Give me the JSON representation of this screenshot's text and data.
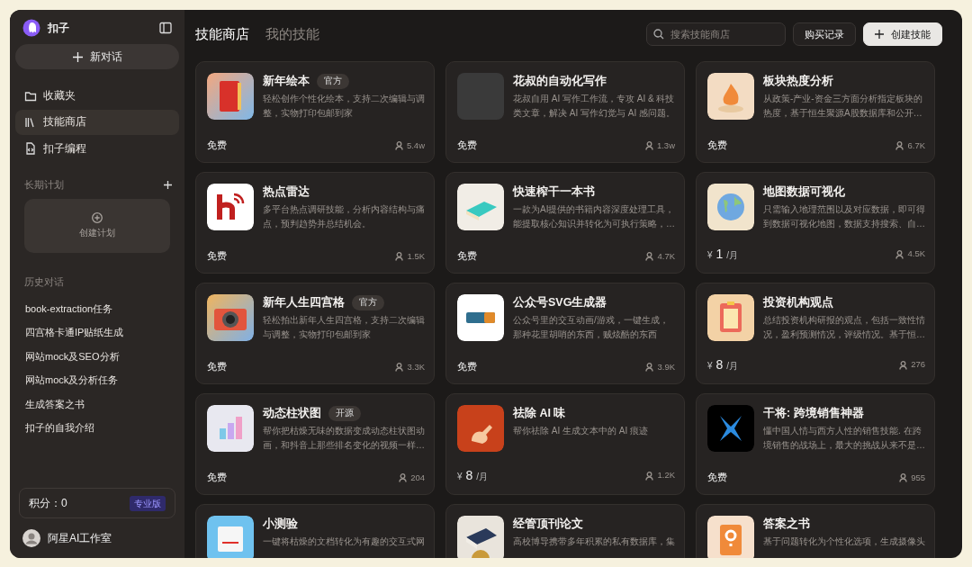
{
  "sidebar": {
    "brand": "扣子",
    "new_chat": "新对话",
    "nav": [
      {
        "label": "收藏夹",
        "selected": false
      },
      {
        "label": "技能商店",
        "selected": true
      },
      {
        "label": "扣子编程",
        "selected": false
      }
    ],
    "plans": {
      "title": "长期计划",
      "create": "创建计划"
    },
    "history": {
      "title": "历史对话",
      "items": [
        "book-extraction任务",
        "四宫格卡通IP贴纸生成",
        "网站mock及SEO分析",
        "网站mock及分析任务",
        "生成答案之书",
        "扣子的自我介绍"
      ]
    },
    "points": {
      "label": "积分：0",
      "badge": "专业版"
    },
    "user": {
      "name": "阿星AI工作室"
    }
  },
  "header": {
    "tabs": [
      {
        "label": "技能商店",
        "selected": true
      },
      {
        "label": "我的技能",
        "selected": false
      }
    ],
    "search": {
      "placeholder": "搜索技能商店"
    },
    "buttons": [
      {
        "label": "购买记录",
        "kind": "plain"
      },
      {
        "label": "创建技能",
        "kind": "primary"
      }
    ]
  },
  "skills": [
    {
      "title": "新年绘本",
      "badge": "官方",
      "desc": "轻松创作个性化绘本，支持二次编辑与调整，实物打印包邮到家",
      "price": {
        "kind": "free",
        "text": "免费"
      },
      "users": "5.4w"
    },
    {
      "title": "花叔的自动化写作",
      "desc": "花叔自用 AI 写作工作流，专攻 AI & 科技类文章，解决 AI 写作幻觉与 AI 感问题。",
      "price": {
        "kind": "free",
        "text": "免费"
      },
      "users": "1.3w"
    },
    {
      "title": "板块热度分析",
      "desc": "从政策-产业-资金三方面分析指定板块的热度，基于恒生聚源A股数据库和公开…",
      "price": {
        "kind": "free",
        "text": "免费"
      },
      "users": "6.7K"
    },
    {
      "title": "热点雷达",
      "desc": "多平台热点调研技能，分析内容结构与痛点，预判趋势并总结机会。",
      "price": {
        "kind": "free",
        "text": "免费"
      },
      "users": "1.5K"
    },
    {
      "title": "快速榨干一本书",
      "desc": "一款为AI提供的书籍内容深度处理工具，能提取核心知识并转化为可执行策略，…",
      "price": {
        "kind": "free",
        "text": "免费"
      },
      "users": "4.7K"
    },
    {
      "title": "地图数据可视化",
      "desc": "只需输入地理范围以及对应数据，即可得到数据可视化地图，数据支持搜索、自…",
      "price": {
        "kind": "paid",
        "currency": "¥",
        "amount": "1",
        "unit": "/月"
      },
      "users": "4.5K"
    },
    {
      "title": "新年人生四宫格",
      "badge": "官方",
      "desc": "轻松拍出新年人生四宫格，支持二次编辑与调整，实物打印包邮到家",
      "price": {
        "kind": "free",
        "text": "免费"
      },
      "users": "3.3K"
    },
    {
      "title": "公众号SVG生成器",
      "desc": "公众号里的交互动画/游戏，一键生成，那种花里胡哨的东西，贼炫酷的东西",
      "price": {
        "kind": "free",
        "text": "免费"
      },
      "users": "3.9K"
    },
    {
      "title": "投资机构观点",
      "desc": "总结投资机构研报的观点，包括一致性情况，盈利预测情况，评级情况。基于恒…",
      "price": {
        "kind": "paid",
        "currency": "¥",
        "amount": "8",
        "unit": "/月"
      },
      "users": "276"
    },
    {
      "title": "动态柱状图",
      "badge": "开源",
      "desc": "帮你把枯燥无味的数据变成动态柱状图动画，和抖音上那些排名变化的视频一样…",
      "price": {
        "kind": "free",
        "text": "免费"
      },
      "users": "204"
    },
    {
      "title": "祛除 AI 味",
      "desc": "帮你祛除 AI 生成文本中的 AI 痕迹",
      "price": {
        "kind": "paid",
        "currency": "¥",
        "amount": "8",
        "unit": "/月"
      },
      "users": "1.2K"
    },
    {
      "title": "干将: 跨境销售神器",
      "desc": "懂中国人情与西方人性的销售技能. 在跨境销售的战场上，最大的挑战从来不是…",
      "price": {
        "kind": "free",
        "text": "免费"
      },
      "users": "955"
    },
    {
      "title": "小测验",
      "desc": "一键将枯燥的文档转化为有趣的交互式网"
    },
    {
      "title": "经管顶刊论文",
      "desc": "高校博导携带多年积累的私有数据库，集"
    },
    {
      "title": "答案之书",
      "desc": "基于问题转化为个性化选项，生成摄像头"
    }
  ]
}
